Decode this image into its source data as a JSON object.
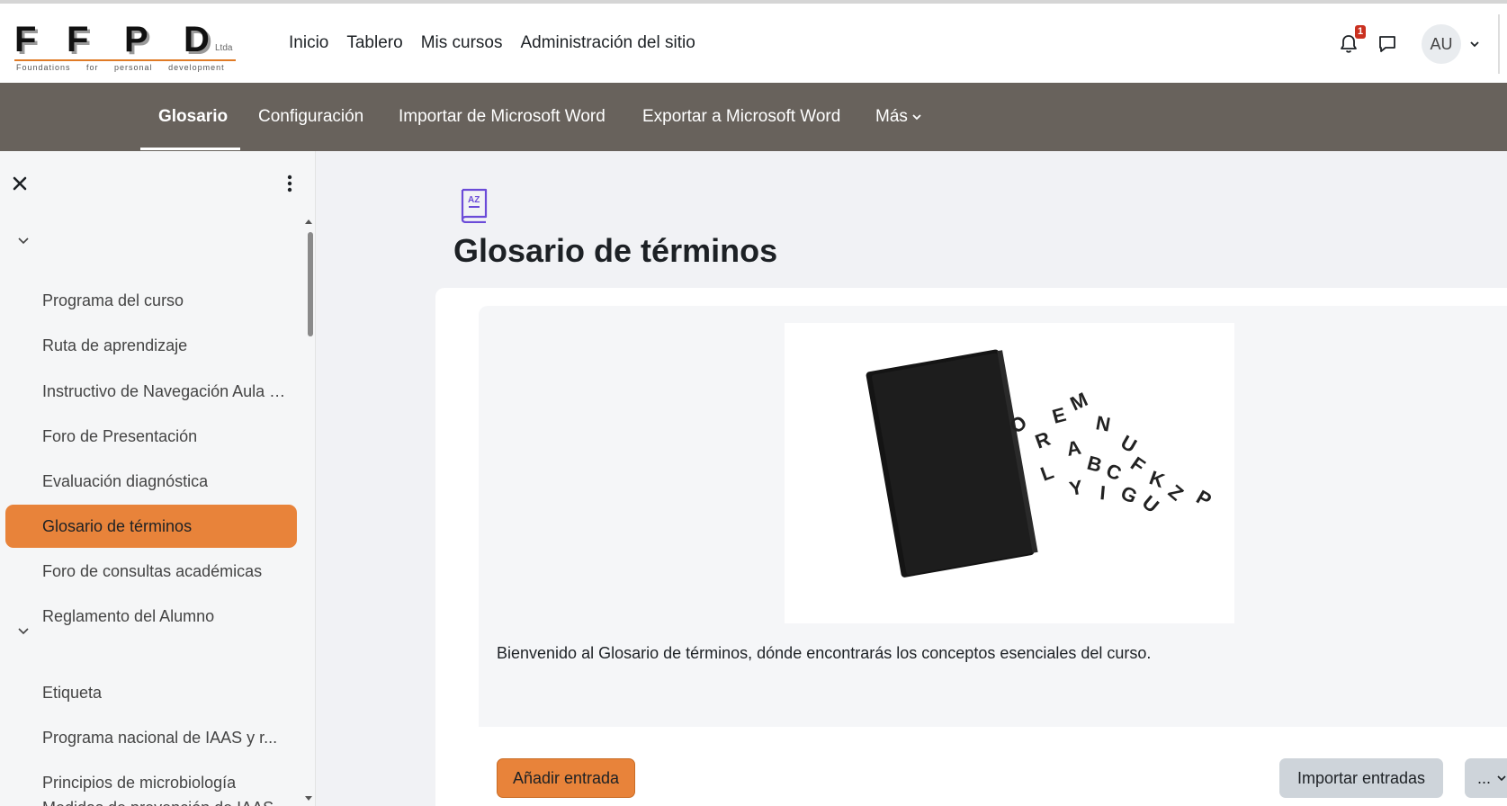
{
  "brand": {
    "letters": [
      "F",
      "F",
      "P",
      "D"
    ],
    "suffix": "Ltda",
    "tagline": "Foundations for personal development"
  },
  "primary_nav": [
    {
      "label": "Inicio"
    },
    {
      "label": "Tablero"
    },
    {
      "label": "Mis cursos"
    },
    {
      "label": "Administración del sitio"
    }
  ],
  "user": {
    "initials": "AU",
    "notification_count": "1"
  },
  "secondary_nav": {
    "tabs": [
      {
        "label": "Glosario"
      },
      {
        "label": "Configuración"
      },
      {
        "label": "Importar de Microsoft Word"
      },
      {
        "label": "Exportar a Microsoft Word"
      },
      {
        "label": "Más"
      }
    ],
    "active": "Glosario"
  },
  "drawer": {
    "section1_items": [
      {
        "label": "Programa del curso"
      },
      {
        "label": "Ruta de aprendizaje"
      },
      {
        "label": "Instructivo de Navegación Aula Virtual"
      },
      {
        "label": "Foro de Presentación"
      },
      {
        "label": "Evaluación diagnóstica"
      },
      {
        "label": "Glosario de términos"
      },
      {
        "label": "Foro de consultas académicas"
      },
      {
        "label": "Reglamento del Alumno"
      }
    ],
    "section2_items": [
      {
        "label": "Etiqueta"
      },
      {
        "label": "Programa nacional de IAAS y r..."
      },
      {
        "label": "Principios de microbiología"
      },
      {
        "label": "Medidas de prevención de IAAS"
      }
    ],
    "active_item": "Glosario de términos"
  },
  "page": {
    "title": "Glosario de términos",
    "intro_text": "Bienvenido al Glosario de términos, dónde encontrarás los conceptos esenciales del curso.",
    "illustration_letters": [
      "M",
      "E",
      "N",
      "U",
      "O",
      "R",
      "A",
      "B",
      "C",
      "F",
      "K",
      "Z",
      "P",
      "L",
      "Y",
      "I",
      "G",
      "U"
    ]
  },
  "actions": {
    "add_entry": "Añadir entrada",
    "import_entries": "Importar entradas",
    "more": "..."
  },
  "colors": {
    "accent": "#e8833a",
    "secondary_nav_bg": "#68625c",
    "page_bg": "#f1f2f5",
    "icon_purple": "#6b4bd8"
  }
}
